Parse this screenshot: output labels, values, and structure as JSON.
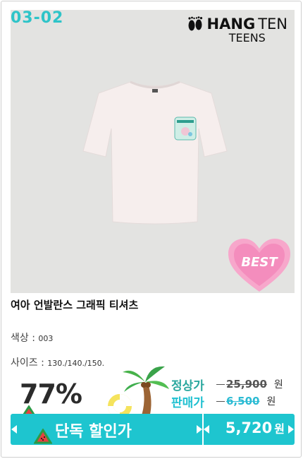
{
  "product": {
    "code": "03-02",
    "brand": {
      "main": "HANG",
      "main_suffix": "TEN",
      "sub": "TEENS"
    },
    "badge": "BEST",
    "title": "여아 언발란스 그래픽 티셔츠",
    "color_label": "색상 : ",
    "color_value": "003",
    "size_label": "사이즈 : ",
    "size_value": "130./140./150."
  },
  "pricing": {
    "discount": "77%",
    "regular_label": "정상가",
    "regular_price": "25,900",
    "sale_label": "판매가",
    "sale_price": "6,500",
    "won": "원",
    "final_label": "단독 할인가",
    "final_price": "5,720",
    "final_won": "원"
  },
  "icons": [
    "footprint-logo-icon",
    "heart-badge-icon",
    "palm-tree-icon",
    "swim-ring-icon",
    "watermelon-icon"
  ],
  "colors": {
    "accent": "#1ec5cf",
    "code": "#2ec4c8",
    "regular_label": "#2aa79e",
    "heart": "#f4a6c8"
  }
}
